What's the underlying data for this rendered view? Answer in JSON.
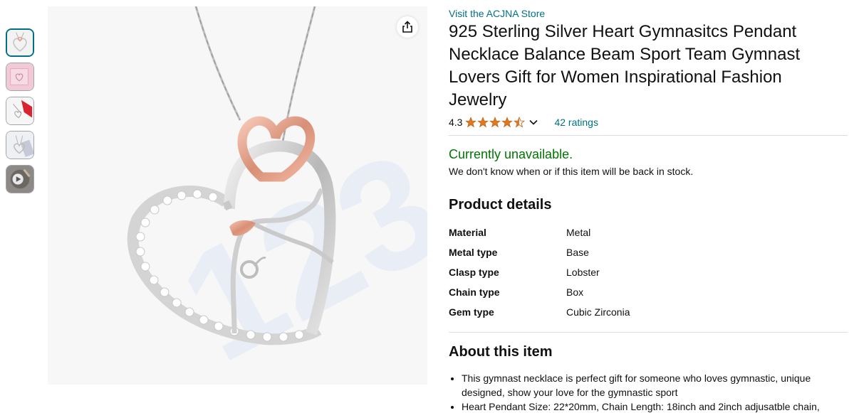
{
  "thumbnails": [
    {
      "name": "thumb-heart-necklace",
      "active": true
    },
    {
      "name": "thumb-pink-box"
    },
    {
      "name": "thumb-red-card"
    },
    {
      "name": "thumb-necklace-card"
    },
    {
      "name": "thumb-video",
      "video": true
    }
  ],
  "share_icon": "share-icon",
  "store": {
    "link_text": "Visit the ACJNA Store"
  },
  "product": {
    "title": "925 Sterling Silver Heart Gymnasitcs Pendant Necklace Balance Beam Sport Team Gymnast Lovers Gift for Women Inspirational Fashion Jewelry"
  },
  "rating": {
    "value": "4.3",
    "stars": 4.3,
    "count_text": "42 ratings"
  },
  "availability": {
    "status": "Currently unavailable.",
    "note": "We don't know when or if this item will be back in stock."
  },
  "product_details": {
    "title": "Product details",
    "rows": [
      {
        "key": "Material",
        "value": "Metal"
      },
      {
        "key": "Metal type",
        "value": "Base"
      },
      {
        "key": "Clasp type",
        "value": "Lobster"
      },
      {
        "key": "Chain type",
        "value": "Box"
      },
      {
        "key": "Gem type",
        "value": "Cubic Zirconia"
      }
    ]
  },
  "about": {
    "title": "About this item",
    "bullets": [
      "This gymnast necklace is perfect gift for someone who loves gymnastic, unique designed, show your love for the gymnastic sport",
      "Heart Pendant Size: 22*20mm, Chain Length: 18inch and 2inch adjusatble chain, adjustable by yourself"
    ]
  },
  "colors": {
    "link": "#007185",
    "available_green": "#007600",
    "star_orange": "#de7921",
    "rose_gold": "#e8a08a"
  }
}
